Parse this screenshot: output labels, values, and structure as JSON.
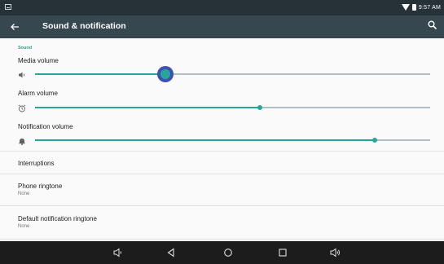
{
  "status_bar": {
    "time": "9:57 AM",
    "icons": [
      "notification-icon",
      "wifi-icon",
      "battery-icon"
    ]
  },
  "app_bar": {
    "title": "Sound & notification",
    "back_icon": "back-arrow-icon",
    "search_icon": "search-icon"
  },
  "sound_section": {
    "header": "Sound",
    "media_volume": {
      "label": "Media volume",
      "level": 0.33,
      "icon": "speaker-icon"
    },
    "alarm_volume": {
      "label": "Alarm volume",
      "level": 0.57,
      "icon": "alarm-clock-icon"
    },
    "notification_volume": {
      "label": "Notification volume",
      "level": 0.86,
      "icon": "bell-icon"
    }
  },
  "rows": {
    "interruptions": {
      "title": "Interruptions"
    },
    "phone_ringtone": {
      "title": "Phone ringtone",
      "summary": "None"
    },
    "default_notification_ringtone": {
      "title": "Default notification ringtone",
      "summary": "None"
    }
  },
  "nav_bar": {
    "buttons": [
      "volume-down-icon",
      "back-icon",
      "home-icon",
      "recents-icon",
      "volume-up-icon"
    ]
  },
  "colors": {
    "status_bar": "#263238",
    "app_bar": "#37474f",
    "accent": "#26a69a",
    "thumb_highlight": "#3f51b5",
    "nav_bar": "#1c1c1c",
    "background": "#fafafa"
  }
}
